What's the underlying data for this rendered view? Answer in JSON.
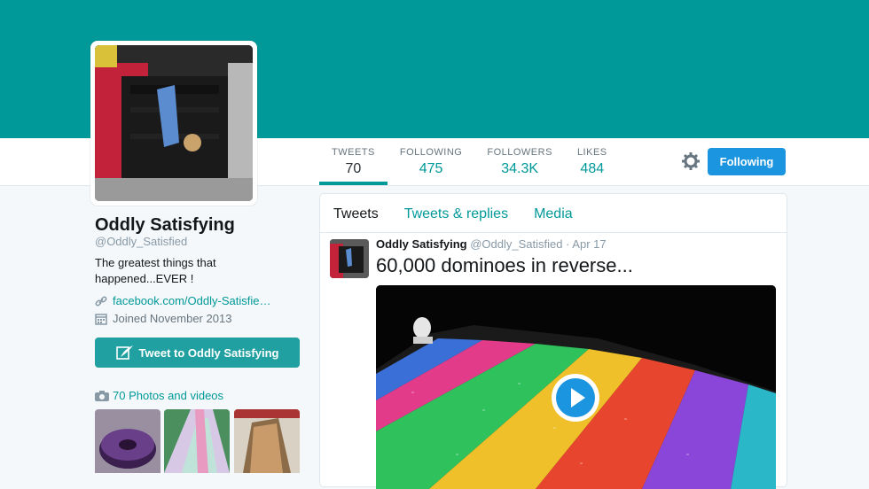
{
  "profile": {
    "name": "Oddly Satisfying",
    "handle": "@Oddly_Satisfied",
    "bio": "The greatest things that happened...EVER !",
    "link": "facebook.com/Oddly-Satisfie…",
    "joined": "Joined November 2013",
    "tweet_to_label": "Tweet to Oddly Satisfying",
    "photos_label": "70 Photos and videos"
  },
  "stats": [
    {
      "label": "TWEETS",
      "value": "70"
    },
    {
      "label": "FOLLOWING",
      "value": "475"
    },
    {
      "label": "FOLLOWERS",
      "value": "34.3K"
    },
    {
      "label": "LIKES",
      "value": "484"
    }
  ],
  "actions": {
    "follow_label": "Following"
  },
  "timeline": {
    "tabs": [
      "Tweets",
      "Tweets & replies",
      "Media"
    ],
    "tweet": {
      "author": "Oddly Satisfying",
      "handle": "@Oddly_Satisfied",
      "date": "· Apr 17",
      "text": "60,000 dominoes in reverse..."
    }
  },
  "colors": {
    "accent": "#009999",
    "follow_button": "#1b95e0",
    "banner": "#009999"
  },
  "icons": [
    "gear-icon",
    "link-icon",
    "calendar-icon",
    "quill-icon",
    "camera-icon",
    "play-icon"
  ]
}
